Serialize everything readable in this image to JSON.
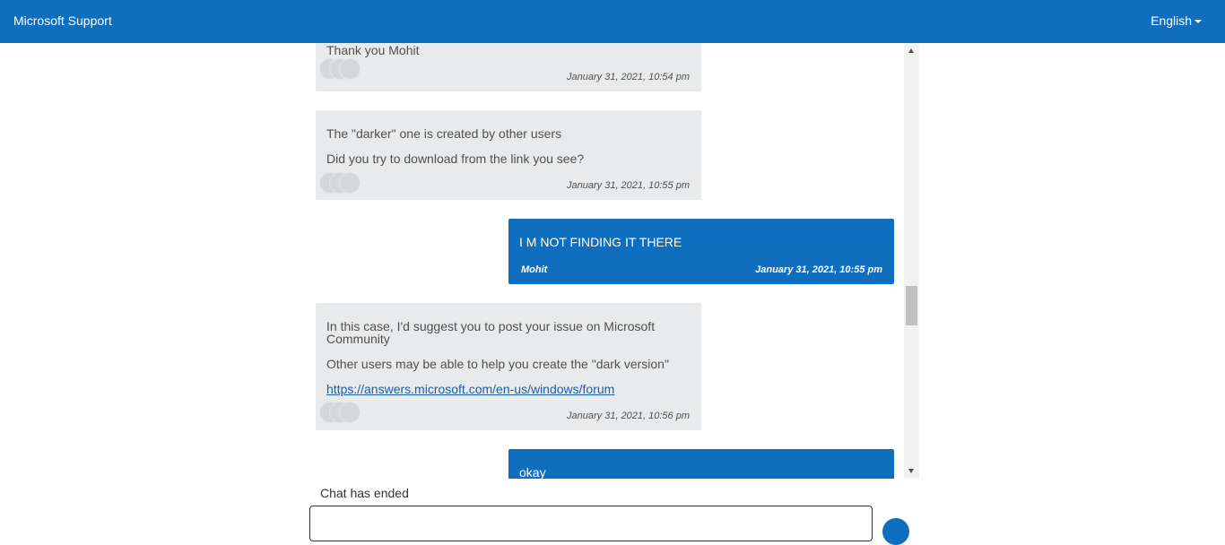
{
  "header": {
    "brand": "Microsoft Support",
    "language": "English"
  },
  "messages": [
    {
      "role": "agent",
      "lines": [
        "Thank you Mohit"
      ],
      "time": "January 31, 2021, 10:54 pm"
    },
    {
      "role": "agent",
      "lines": [
        "The \"darker\" one is created by other users",
        "Did you try to download from the link you see?"
      ],
      "time": "January 31, 2021, 10:55 pm"
    },
    {
      "role": "user",
      "lines": [
        "I M NOT FINDING IT THERE"
      ],
      "sender": "Mohit",
      "time": "January 31, 2021, 10:55 pm"
    },
    {
      "role": "agent",
      "lines": [
        "In this case, I'd suggest you to post your issue on Microsoft",
        "Community",
        "Other users may be able to help you create the \"dark version\""
      ],
      "link": "https://answers.microsoft.com/en-us/windows/forum",
      "time": "January 31, 2021, 10:56 pm"
    },
    {
      "role": "user",
      "lines": [
        "okay"
      ]
    }
  ],
  "status": "Chat has ended",
  "colors": {
    "brand_blue": "#106ebe",
    "agent_bubble": "#e9eaeb"
  }
}
